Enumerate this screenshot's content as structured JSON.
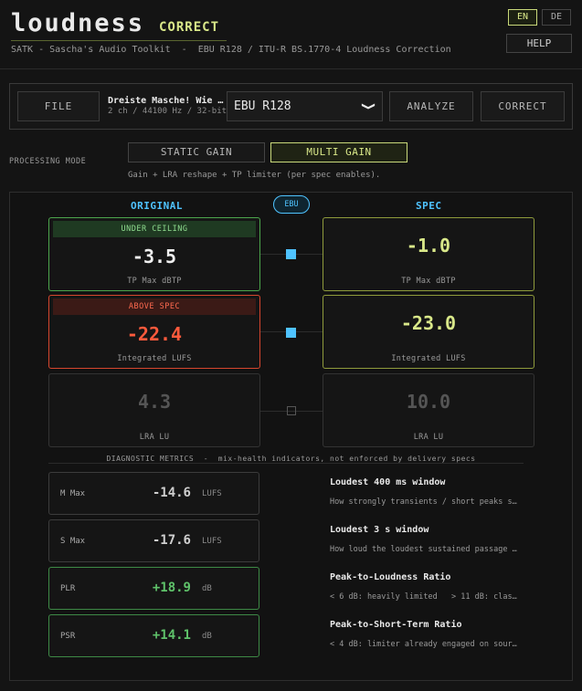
{
  "app": {
    "title": "loudness",
    "badge": "CORRECT",
    "subtitle": "SATK - Sascha's Audio Toolkit  -  EBU R128 / ITU-R BS.1770-4 Loudness Correction"
  },
  "header": {
    "lang_en": "EN",
    "lang_de": "DE",
    "help_label": "HELP"
  },
  "toolbar": {
    "file_label": "FILE",
    "file_name": "Dreiste Masche! Wie …",
    "file_meta": "2 ch / 44100 Hz / 32-bit",
    "spec_selected": "EBU R128",
    "spec_chevron": "❯",
    "analyze_label": "ANALYZE",
    "correct_label": "CORRECT"
  },
  "processing": {
    "label": "PROCESSING MODE",
    "static_label": "STATIC GAIN",
    "multi_label": "MULTI GAIN",
    "description": "Gain + LRA reshape + TP limiter (per spec enables)."
  },
  "comparison": {
    "original_header": "ORIGINAL",
    "spec_header": "SPEC",
    "ebu_pill": "EBU",
    "rows": [
      {
        "original": {
          "badge": "UNDER CEILING",
          "value": "-3.5",
          "unit": "TP Max  dBTP"
        },
        "spec": {
          "value": "-1.0",
          "unit": "TP Max  dBTP"
        }
      },
      {
        "original": {
          "badge": "ABOVE SPEC",
          "value": "-22.4",
          "unit": "Integrated  LUFS"
        },
        "spec": {
          "value": "-23.0",
          "unit": "Integrated  LUFS"
        }
      },
      {
        "original": {
          "value": "4.3",
          "unit": "LRA  LU"
        },
        "spec": {
          "value": "10.0",
          "unit": "LRA  LU"
        }
      }
    ],
    "colors": {
      "accent": "#4fc3ff",
      "ok": "#4ca64c",
      "fail": "#d6462e",
      "spec": "#d9e889"
    }
  },
  "diagnostics": {
    "title": "DIAGNOSTIC METRICS  -  mix-health indicators, not enforced by delivery specs",
    "metrics": [
      {
        "name": "M Max",
        "value": "-14.6",
        "unit": "LUFS"
      },
      {
        "name": "S Max",
        "value": "-17.6",
        "unit": "LUFS"
      },
      {
        "name": "PLR",
        "value": "+18.9",
        "unit": "dB"
      },
      {
        "name": "PSR",
        "value": "+14.1",
        "unit": "dB"
      }
    ],
    "descriptions": [
      {
        "title": "Loudest 400 ms window",
        "text": "How strongly transients / short peaks s…"
      },
      {
        "title": "Loudest 3 s window",
        "text": "How loud the loudest sustained passage …"
      },
      {
        "title": "Peak-to-Loudness Ratio",
        "text": "< 6 dB: heavily limited   > 11 dB: clas…"
      },
      {
        "title": "Peak-to-Short-Term Ratio",
        "text": "< 4 dB: limiter already engaged on sour…"
      }
    ]
  }
}
